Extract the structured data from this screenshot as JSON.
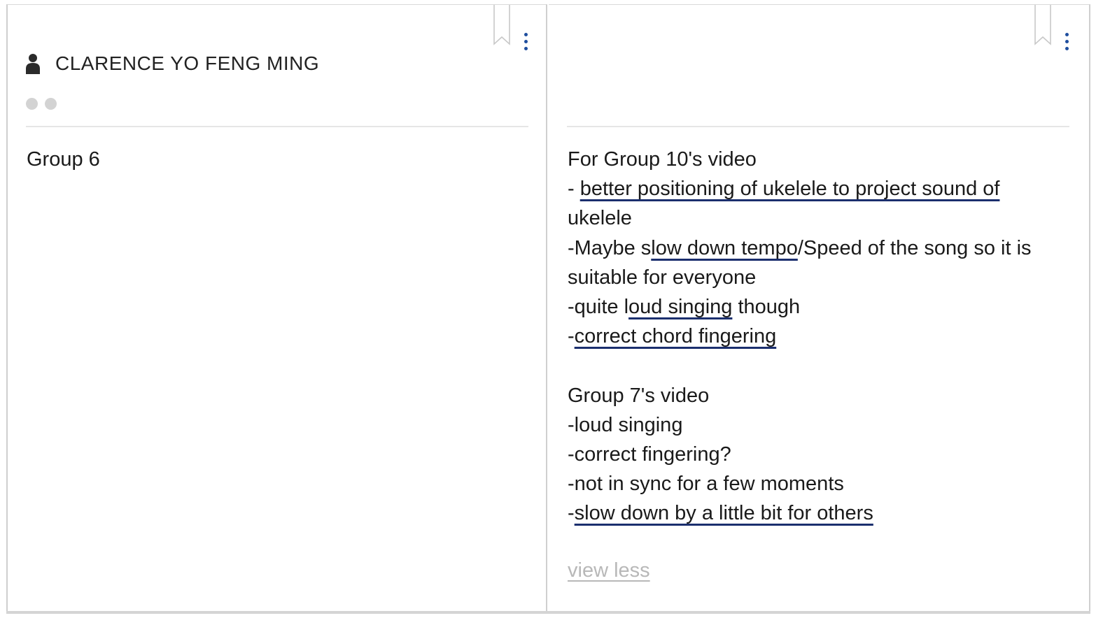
{
  "cards": [
    {
      "author": "CLARENCE YO FENG MING",
      "body": "Group 6"
    },
    {
      "author": "",
      "lines": [
        {
          "segments": [
            {
              "text": "For Group 10's video"
            }
          ]
        },
        {
          "segments": [
            {
              "text": "- "
            },
            {
              "text": "better positioning of ukelele to project sound of",
              "underline": true
            }
          ]
        },
        {
          "segments": [
            {
              "text": "ukelele"
            }
          ]
        },
        {
          "segments": [
            {
              "text": "-Maybe s"
            },
            {
              "text": "low down tempo",
              "underline": true
            },
            {
              "text": "/Speed of the song so it is"
            }
          ]
        },
        {
          "segments": [
            {
              "text": "suitable for everyone"
            }
          ]
        },
        {
          "segments": [
            {
              "text": "-quite l"
            },
            {
              "text": "oud singing",
              "underline": true
            },
            {
              "text": " though"
            }
          ]
        },
        {
          "segments": [
            {
              "text": "-"
            },
            {
              "text": "correct chord fingering",
              "underline": true
            }
          ]
        },
        {
          "segments": [
            {
              "text": ""
            }
          ]
        },
        {
          "segments": [
            {
              "text": "Group 7's video"
            }
          ]
        },
        {
          "segments": [
            {
              "text": "-loud singing"
            }
          ]
        },
        {
          "segments": [
            {
              "text": "-correct fingering?"
            }
          ]
        },
        {
          "segments": [
            {
              "text": "-not in sync for a few moments"
            }
          ]
        },
        {
          "segments": [
            {
              "text": "-"
            },
            {
              "text": "slow down by a little bit for others",
              "underline": true
            }
          ]
        }
      ],
      "view_less_label": "view less"
    }
  ],
  "icons": {
    "user": "user-icon",
    "bookmark": "bookmark-icon",
    "more": "more-vertical-icon"
  },
  "colors": {
    "accent": "#1f4e9e",
    "ink": "#1b2f6e",
    "muted_link": "#b8b8b8",
    "reaction_dot": "#d3d3d3"
  }
}
